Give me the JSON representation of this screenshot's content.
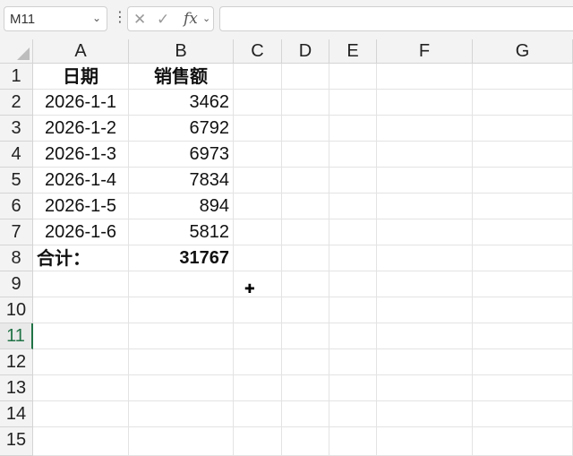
{
  "formula_bar": {
    "name_box": "M11",
    "name_box_icon": "chevron-down-icon",
    "more_icon": "kebab-icon",
    "cancel_icon": "✕",
    "enter_icon": "✓",
    "fx_label": "fx",
    "formula_value": ""
  },
  "columns": [
    "A",
    "B",
    "C",
    "D",
    "E",
    "F",
    "G"
  ],
  "rows": [
    "1",
    "2",
    "3",
    "4",
    "5",
    "6",
    "7",
    "8",
    "9",
    "10",
    "11",
    "12",
    "13",
    "14",
    "15"
  ],
  "selected_row": "11",
  "cells": {
    "A1": "日期",
    "B1": "销售额",
    "A2": "2026-1-1",
    "B2": "3462",
    "A3": "2026-1-2",
    "B3": "6792",
    "A4": "2026-1-3",
    "B4": "6973",
    "A5": "2026-1-4",
    "B5": "7834",
    "A6": "2026-1-5",
    "B6": "894",
    "A7": "2026-1-6",
    "B7": "5812",
    "A8": "合计：",
    "B8": "31767"
  },
  "colors": {
    "accent": "#217346",
    "header_bg": "#f3f3f3",
    "grid": "#e3e3e3"
  }
}
